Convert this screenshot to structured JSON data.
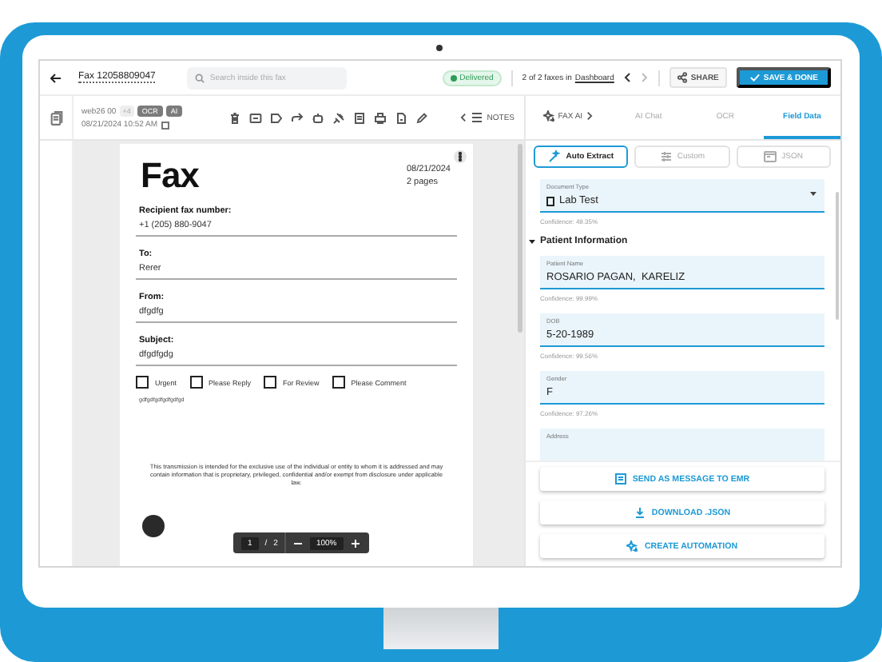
{
  "header": {
    "title": "Fax 12058809047",
    "search_placeholder": "Search inside this fax",
    "status": "Delivered",
    "position": "2 of 2 faxes in",
    "folder": "Dashboard",
    "share": "SHARE",
    "save": "SAVE & DONE"
  },
  "meta": {
    "sender": "web26 00",
    "extra": "+4",
    "tags": [
      "OCR",
      "AI"
    ],
    "timestamp": "08/21/2024 10:52 AM"
  },
  "notes_label": "NOTES",
  "panel_tabs": [
    {
      "label": "FAX AI",
      "kind": "menu",
      "selected": false
    },
    {
      "label": "AI Chat",
      "kind": "tab",
      "selected": false
    },
    {
      "label": "OCR",
      "kind": "tab",
      "selected": false
    },
    {
      "label": "Field Data",
      "kind": "tab",
      "selected": true
    }
  ],
  "modes": [
    {
      "label": "Auto Extract",
      "selected": true
    },
    {
      "label": "Custom",
      "selected": false
    },
    {
      "label": "JSON",
      "selected": false
    }
  ],
  "document_type": {
    "label": "Document Type",
    "value": "Lab Test",
    "confidence": "Confidence: 49.35%"
  },
  "section": {
    "title": "Patient Information",
    "expanded": true,
    "fields": [
      {
        "label": "Patient Name",
        "value": "ROSARIO PAGAN,  KARELIZ",
        "confidence": "Confidence: 99.99%"
      },
      {
        "label": "DOB",
        "value": "5-20-1989",
        "confidence": "Confidence: 99.56%"
      },
      {
        "label": "Gender",
        "value": "F",
        "confidence": "Confidence: 97.26%"
      },
      {
        "label": "Address"
      }
    ]
  },
  "actions": [
    {
      "label": "SEND AS MESSAGE TO EMR",
      "kind": "send"
    },
    {
      "label": "DOWNLOAD .JSON",
      "kind": "download"
    },
    {
      "label": "CREATE AUTOMATION",
      "kind": "automation"
    }
  ],
  "fax_page": {
    "heading": "Fax",
    "date": "08/21/2024",
    "pages": "2 pages",
    "fields": [
      {
        "label": "Recipient fax number:",
        "value": "+1 (205) 880-9047"
      },
      {
        "label": "To:",
        "value": "Rerer"
      },
      {
        "label": "From:",
        "value": "dfgdfg"
      },
      {
        "label": "Subject:",
        "value": "dfgdfgdg"
      }
    ],
    "checkboxes": [
      {
        "label": "Urgent",
        "checked": false
      },
      {
        "label": "Please Reply",
        "checked": false
      },
      {
        "label": "For Review",
        "checked": false
      },
      {
        "label": "Please Comment",
        "checked": false
      }
    ],
    "note": "gdfgdfgdfgdfgdfgd",
    "disclaimer": "This transmission is intended for the exclusive use of the individual or entity to whom it is addressed and may contain information that is proprietary, privileged, confidential and/or exempt from disclosure under applicable law."
  },
  "pager": {
    "page": "1",
    "separator": "/",
    "total": "2",
    "zoom": "100%"
  }
}
